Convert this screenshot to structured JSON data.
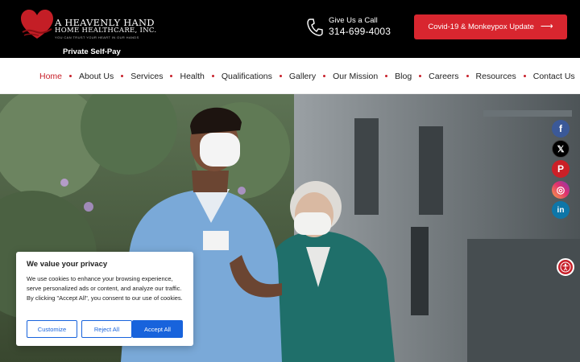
{
  "brand": {
    "title": "A HEAVENLY HAND",
    "subtitle": "HOME HEALTHCARE, INC.",
    "tagline": "YOU CAN TRUST YOUR HEART IN OUR HANDS",
    "private_pay": "Private Self-Pay",
    "accent_color": "#d8262f"
  },
  "contact": {
    "label": "Give Us a Call",
    "phone": "314-699-4003"
  },
  "covid_button": {
    "label": "Covid-19 & Monkeypox Update",
    "icon": "arrow-right-icon"
  },
  "nav": {
    "items": [
      {
        "label": "Home",
        "active": true
      },
      {
        "label": "About Us"
      },
      {
        "label": "Services"
      },
      {
        "label": "Health"
      },
      {
        "label": "Qualifications"
      },
      {
        "label": "Gallery"
      },
      {
        "label": "Our Mission"
      },
      {
        "label": "Blog"
      },
      {
        "label": "Careers"
      },
      {
        "label": "Resources"
      },
      {
        "label": "Contact Us"
      }
    ]
  },
  "social": [
    {
      "icon": "facebook-icon",
      "glyph": "f"
    },
    {
      "icon": "x-twitter-icon",
      "glyph": "𝕏"
    },
    {
      "icon": "pinterest-icon",
      "glyph": "P"
    },
    {
      "icon": "instagram-icon",
      "glyph": "◎"
    },
    {
      "icon": "linkedin-icon",
      "glyph": "in"
    }
  ],
  "accessibility": {
    "icon": "accessibility-icon"
  },
  "cookie": {
    "title": "We value your privacy",
    "text": "We use cookies to enhance your browsing experience, serve personalized ads or content, and analyze our traffic. By clicking \"Accept All\", you consent to our use of cookies.",
    "customize": "Customize",
    "reject": "Reject All",
    "accept": "Accept All",
    "button_color": "#1863dc"
  }
}
